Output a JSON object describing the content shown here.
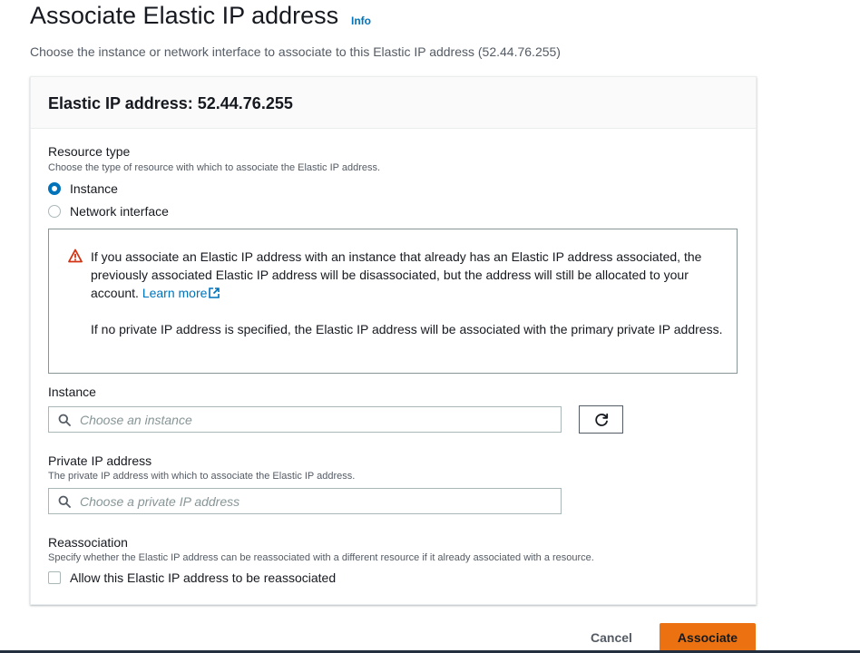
{
  "page": {
    "title": "Associate Elastic IP address",
    "info_label": "Info",
    "description": "Choose the instance or network interface to associate to this Elastic IP address (52.44.76.255)"
  },
  "panel": {
    "title": "Elastic IP address: 52.44.76.255"
  },
  "resource_type": {
    "label": "Resource type",
    "description": "Choose the type of resource with which to associate the Elastic IP address.",
    "options": [
      {
        "label": "Instance",
        "selected": true
      },
      {
        "label": "Network interface",
        "selected": false
      }
    ]
  },
  "alert": {
    "text_1": "If you associate an Elastic IP address with an instance that already has an Elastic IP address associated, the previously associated Elastic IP address will be disassociated, but the address will still be allocated to your account.",
    "link_label": "Learn more",
    "text_2": "If no private IP address is specified, the Elastic IP address will be associated with the primary private IP address.",
    "icon": "warning-icon",
    "color": "#d13212"
  },
  "instance": {
    "label": "Instance",
    "placeholder": "Choose an instance",
    "value": ""
  },
  "private_ip": {
    "label": "Private IP address",
    "description": "The private IP address with which to associate the Elastic IP address.",
    "placeholder": "Choose a private IP address",
    "value": ""
  },
  "reassociation": {
    "label": "Reassociation",
    "description": "Specify whether the Elastic IP address can be reassociated with a different resource if it already associated with a resource.",
    "checkbox_label": "Allow this Elastic IP address to be reassociated",
    "checked": false
  },
  "actions": {
    "cancel_label": "Cancel",
    "associate_label": "Associate",
    "primary_color": "#ec7211"
  }
}
